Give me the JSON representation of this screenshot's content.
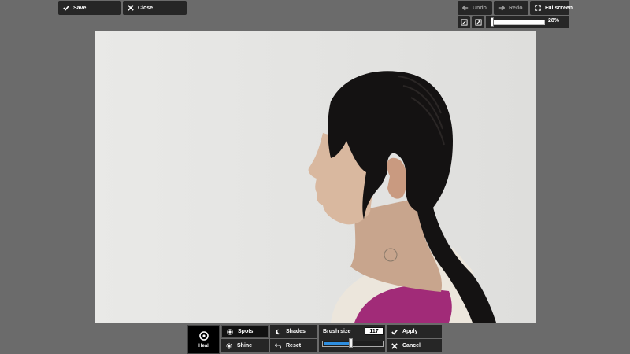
{
  "toolbar": {
    "save_label": "Save",
    "close_label": "Close",
    "undo_label": "Undo",
    "redo_label": "Redo",
    "fullscreen_label": "Fullscreen",
    "zoom_text": "28%",
    "zoom_level": 0.28
  },
  "tools": {
    "heal_label": "Heal",
    "spots_label": "Spots",
    "shades_label": "Shades",
    "shine_label": "Shine",
    "reset_label": "Reset",
    "brush_size_label": "Brush size",
    "brush_size_value": "117",
    "brush_size_level": 0.46,
    "apply_label": "Apply",
    "cancel_label": "Cancel"
  },
  "colors": {
    "background": "#6b6b6b",
    "panel": "#262626",
    "accent": "#2e8ee0"
  }
}
